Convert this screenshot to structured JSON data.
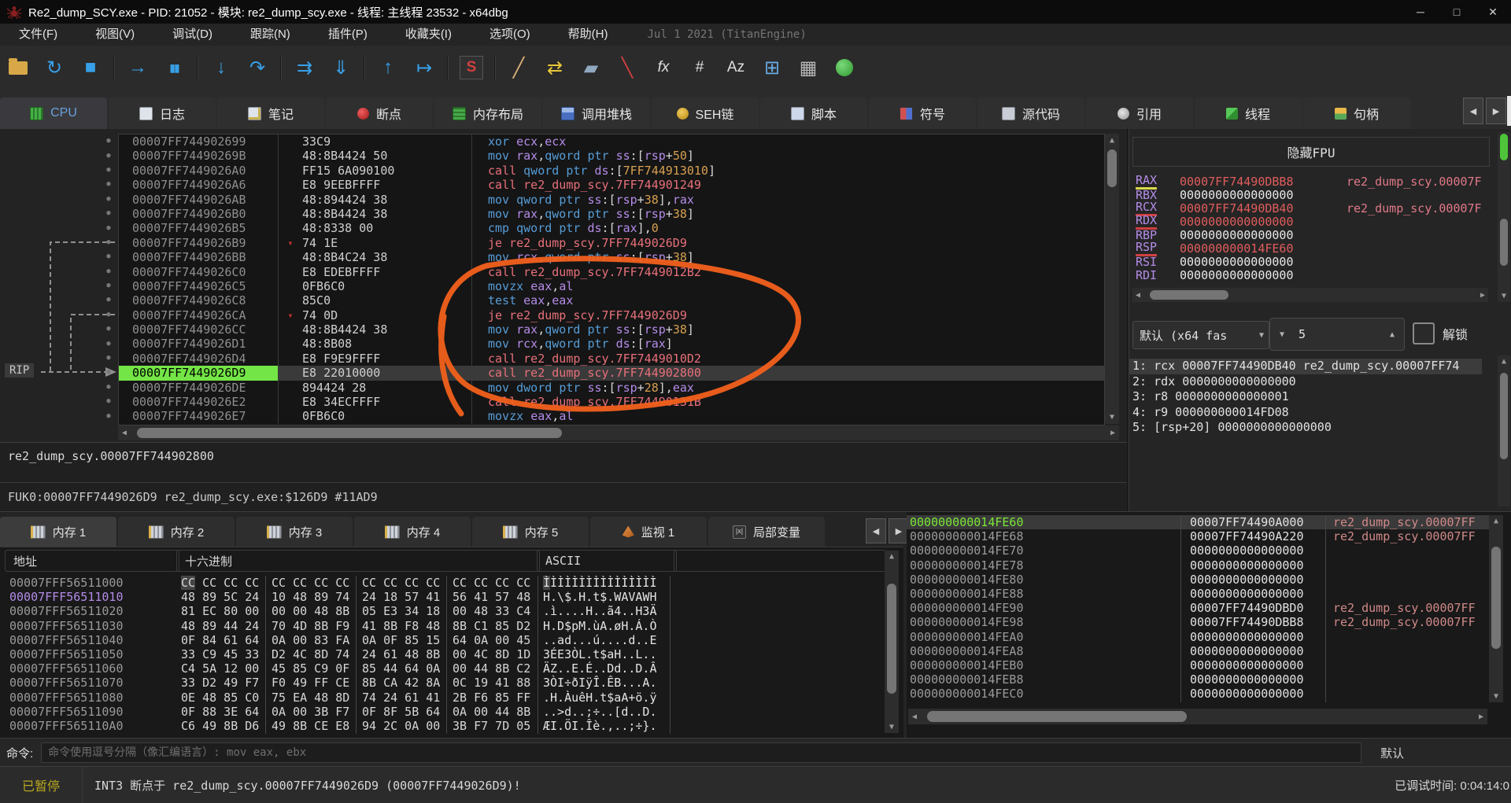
{
  "title_bar": {
    "title": "Re2_dump_SCY.exe - PID: 21052 - 模块: re2_dump_scy.exe - 线程: 主线程 23532 - x64dbg",
    "window_buttons": [
      "─",
      "□",
      "✕"
    ]
  },
  "menu_bar": {
    "items": [
      "文件(F)",
      "视图(V)",
      "调试(D)",
      "跟踪(N)",
      "插件(P)",
      "收藏夹(I)",
      "选项(O)",
      "帮助(H)"
    ],
    "build_info": "Jul 1 2021 (TitanEngine)"
  },
  "icons": {
    "up": "▲",
    "down": "▼",
    "left": "◀",
    "right": "▶",
    "jump_down": "▾",
    "dot": "●"
  },
  "toolbar": {
    "buttons": [
      {
        "name": "open-file-icon",
        "glyph": "",
        "color": "#d8a848",
        "kind": "folder"
      },
      {
        "name": "restart-icon",
        "glyph": "↻",
        "color": "#38a0e8"
      },
      {
        "name": "stop-icon",
        "glyph": "■",
        "color": "#38a0e8"
      },
      {
        "sep": true
      },
      {
        "name": "run-icon",
        "glyph": "→",
        "color": "#38a0e8"
      },
      {
        "name": "pause-icon",
        "glyph": "▮▮",
        "color": "#38a0e8",
        "small": true
      },
      {
        "sep": true
      },
      {
        "name": "step-into-icon",
        "glyph": "↓",
        "color": "#38a0e8"
      },
      {
        "name": "step-over-icon",
        "glyph": "↷",
        "color": "#38a0e8"
      },
      {
        "sep": true
      },
      {
        "name": "execute-till-return-icon",
        "glyph": "⇉",
        "color": "#38a0e8"
      },
      {
        "name": "run-to-user-code-icon",
        "glyph": "⇓",
        "color": "#38a0e8"
      },
      {
        "sep": true
      },
      {
        "name": "step-out-icon",
        "glyph": "↑",
        "color": "#38a0e8"
      },
      {
        "name": "run-until-expression-icon",
        "glyph": "↦",
        "color": "#38a0e8"
      },
      {
        "sep": true
      },
      {
        "name": "scylla-icon",
        "glyph": "S",
        "color": "#d04040",
        "kind": "scylla"
      },
      {
        "sep": true
      },
      {
        "name": "patch-icon",
        "glyph": "╱",
        "color": "#d8b078"
      },
      {
        "name": "fat-arrows-icon",
        "glyph": "⇄",
        "color": "#e8c838"
      },
      {
        "name": "eraser-icon",
        "glyph": "▰",
        "color": "#90a8c0"
      },
      {
        "name": "highlight-icon",
        "glyph": "╲",
        "color": "#d04040"
      },
      {
        "name": "function-fx-icon",
        "glyph": "fx",
        "color": "#e0e0e0",
        "text": true
      },
      {
        "name": "hash-icon",
        "glyph": "#",
        "color": "#e0e0e0",
        "text": true
      },
      {
        "name": "font-az-icon",
        "glyph": "Az",
        "color": "#e0e0e0",
        "text": true
      },
      {
        "name": "new-dump-window-icon",
        "glyph": "⊞",
        "color": "#68a8e0"
      },
      {
        "name": "calculator-icon",
        "glyph": "▦",
        "color": "#b8b8b8"
      },
      {
        "name": "internet-icon",
        "glyph": "",
        "color": "#48b848",
        "kind": "globe"
      }
    ]
  },
  "cpu_tabs": [
    {
      "label": "CPU",
      "icon": "cpu",
      "active": true
    },
    {
      "label": "日志",
      "icon": "log"
    },
    {
      "label": "笔记",
      "icon": "notes"
    },
    {
      "label": "断点",
      "icon": "breakpoint"
    },
    {
      "label": "内存布局",
      "icon": "memory-map"
    },
    {
      "label": "调用堆栈",
      "icon": "call-stack"
    },
    {
      "label": "SEH链",
      "icon": "seh"
    },
    {
      "label": "脚本",
      "icon": "script"
    },
    {
      "label": "符号",
      "icon": "symbols"
    },
    {
      "label": "源代码",
      "icon": "source"
    },
    {
      "label": "引用",
      "icon": "references"
    },
    {
      "label": "线程",
      "icon": "threads"
    },
    {
      "label": "句柄",
      "icon": "handles"
    }
  ],
  "disasm": {
    "rip_label": "RIP",
    "rows": [
      {
        "addr": "00007FF744902699",
        "bytes": "33C9",
        "instr": "xor ecx,ecx"
      },
      {
        "addr": "00007FF74490269B",
        "bytes": "48:8B4424 50",
        "instr": "mov rax,qword ptr ss:[rsp+50]"
      },
      {
        "addr": "00007FF7449026A0",
        "bytes": "FF15 6A090100",
        "instr": "call qword ptr ds:[7FF744913010]"
      },
      {
        "addr": "00007FF7449026A6",
        "bytes": "E8 9EEBFFFF",
        "instr": "call re2_dump_scy.7FF744901249"
      },
      {
        "addr": "00007FF7449026AB",
        "bytes": "48:894424 38",
        "instr": "mov qword ptr ss:[rsp+38],rax"
      },
      {
        "addr": "00007FF7449026B0",
        "bytes": "48:8B4424 38",
        "instr": "mov rax,qword ptr ss:[rsp+38]"
      },
      {
        "addr": "00007FF7449026B5",
        "bytes": "48:8338 00",
        "instr": "cmp qword ptr ds:[rax],0"
      },
      {
        "addr": "00007FF7449026B9",
        "bytes": "74 1E",
        "instr": "je re2_dump_scy.7FF7449026D9",
        "jump": true
      },
      {
        "addr": "00007FF7449026BB",
        "bytes": "48:8B4C24 38",
        "instr": "mov rcx,qword ptr ss:[rsp+38]"
      },
      {
        "addr": "00007FF7449026C0",
        "bytes": "E8 EDEBFFFF",
        "instr": "call re2_dump_scy.7FF7449012B2"
      },
      {
        "addr": "00007FF7449026C5",
        "bytes": "0FB6C0",
        "instr": "movzx eax,al"
      },
      {
        "addr": "00007FF7449026C8",
        "bytes": "85C0",
        "instr": "test eax,eax"
      },
      {
        "addr": "00007FF7449026CA",
        "bytes": "74 0D",
        "instr": "je re2_dump_scy.7FF7449026D9",
        "jump": true
      },
      {
        "addr": "00007FF7449026CC",
        "bytes": "48:8B4424 38",
        "instr": "mov rax,qword ptr ss:[rsp+38]"
      },
      {
        "addr": "00007FF7449026D1",
        "bytes": "48:8B08",
        "instr": "mov rcx,qword ptr ds:[rax]"
      },
      {
        "addr": "00007FF7449026D4",
        "bytes": "E8 F9E9FFFF",
        "instr": "call re2_dump_scy.7FF7449010D2"
      },
      {
        "addr": "00007FF7449026D9",
        "bytes": "E8 22010000",
        "instr": "call re2_dump_scy.7FF744902800",
        "rip": true
      },
      {
        "addr": "00007FF7449026DE",
        "bytes": "894424 28",
        "instr": "mov dword ptr ss:[rsp+28],eax"
      },
      {
        "addr": "00007FF7449026E2",
        "bytes": "E8 34ECFFFF",
        "instr": "call re2_dump_scy.7FF74490131B"
      },
      {
        "addr": "00007FF7449026E7",
        "bytes": "0FB6C0",
        "instr": "movzx eax,al"
      }
    ],
    "info_line": "re2_dump_scy.00007FF744902800",
    "status_line": "FUK0:00007FF7449026D9 re2_dump_scy.exe:$126D9 #11AD9"
  },
  "registers": {
    "title": "隐藏FPU",
    "rows": [
      {
        "name": "RAX",
        "value": "00007FF74490DBB8",
        "comment": "re2_dump_scy.00007F",
        "changed": true,
        "mark": "yellow"
      },
      {
        "name": "RBX",
        "value": "0000000000000000",
        "changed": false
      },
      {
        "name": "RCX",
        "value": "00007FF74490DB40",
        "comment": "re2_dump_scy.00007F",
        "changed": true,
        "mark": "red"
      },
      {
        "name": "RDX",
        "value": "0000000000000000",
        "changed": true,
        "mark": "red"
      },
      {
        "name": "RBP",
        "value": "0000000000000000",
        "changed": false
      },
      {
        "name": "RSP",
        "value": "000000000014FE60",
        "changed": true,
        "mark": "red"
      },
      {
        "name": "RSI",
        "value": "0000000000000000",
        "changed": false
      },
      {
        "name": "RDI",
        "value": "0000000000000000",
        "changed": false
      }
    ]
  },
  "args_panel": {
    "convention": "默认 (x64 fas",
    "spin_value": "5",
    "unlock": "解锁",
    "rows": [
      "1: rcx 00007FF74490DB40 re2_dump_scy.00007FF74",
      "2: rdx 0000000000000000",
      "3: r8 0000000000000001",
      "4: r9 000000000014FD08",
      "5: [rsp+20] 0000000000000000"
    ],
    "selected_index": 0
  },
  "bottom_tabs": [
    {
      "label": "内存 1",
      "icon": "memory",
      "active": true
    },
    {
      "label": "内存 2",
      "icon": "memory"
    },
    {
      "label": "内存 3",
      "icon": "memory"
    },
    {
      "label": "内存 4",
      "icon": "memory"
    },
    {
      "label": "内存 5",
      "icon": "memory"
    },
    {
      "label": "监视 1",
      "icon": "watch"
    },
    {
      "label": "局部变量",
      "icon": "locals"
    }
  ],
  "dump": {
    "headers": {
      "address": "地址",
      "hex": "十六进制",
      "ascii": "ASCII"
    },
    "rows": [
      {
        "addr": "00007FFF56511000",
        "hex": [
          "CC CC CC CC",
          "CC CC CC CC",
          "CC CC CC CC",
          "CC CC CC CC"
        ],
        "ascii": "ÌÌÌÌÌÌÌÌÌÌÌÌÌÌÌÌ",
        "cursor": true
      },
      {
        "addr": "00007FFF56511010",
        "hex": [
          "48 89 5C 24",
          "10 48 89 74",
          "24 18 57 41",
          "56 41 57 48"
        ],
        "ascii": "H.\\$.H.t$.WAVAWH",
        "sel": true
      },
      {
        "addr": "00007FFF56511020",
        "hex": [
          "81 EC 80 00",
          "00 00 48 8B",
          "05 E3 34 18",
          "00 48 33 C4"
        ],
        "ascii": ".ì....H..ã4..H3Ä"
      },
      {
        "addr": "00007FFF56511030",
        "hex": [
          "48 89 44 24",
          "70 4D 8B F9",
          "41 8B F8 48",
          "8B C1 85 D2"
        ],
        "ascii": "H.D$pM.ùA.øH.Á.Ò"
      },
      {
        "addr": "00007FFF56511040",
        "hex": [
          "0F 84 61 64",
          "0A 00 83 FA",
          "0A 0F 85 15",
          "64 0A 00 45"
        ],
        "ascii": "..ad...ú....d..E"
      },
      {
        "addr": "00007FFF56511050",
        "hex": [
          "33 C9 45 33",
          "D2 4C 8D 74",
          "24 61 48 8B",
          "00 4C 8D 1D"
        ],
        "ascii": "3ÉE3ÒL.t$aH..L.."
      },
      {
        "addr": "00007FFF56511060",
        "hex": [
          "C4 5A 12 00",
          "45 85 C9 0F",
          "85 44 64 0A",
          "00 44 8B C2"
        ],
        "ascii": "ÄZ..E.É..Dd..D.Â"
      },
      {
        "addr": "00007FFF56511070",
        "hex": [
          "33 D2 49 F7",
          "F0 49 FF CE",
          "8B CA 42 8A",
          "0C 19 41 88"
        ],
        "ascii": "3ÒI÷ðIÿÎ.ÊB...A."
      },
      {
        "addr": "00007FFF56511080",
        "hex": [
          "0E 48 85 C0",
          "75 EA 48 8D",
          "74 24 61 41",
          "2B F6 85 FF"
        ],
        "ascii": ".H.ÀuêH.t$aA+ö.ÿ"
      },
      {
        "addr": "00007FFF56511090",
        "hex": [
          "0F 88 3E 64",
          "0A 00 3B F7",
          "0F 8F 5B 64",
          "0A 00 44 8B"
        ],
        "ascii": "..>d..;÷..[d..D."
      },
      {
        "addr": "00007FFF565110A0",
        "hex": [
          "C6 49 8B D6",
          "49 8B CE E8",
          "94 2C 0A 00",
          "3B F7 7D 05"
        ],
        "ascii": "ÆI.ÖI.Îè.,..;÷}."
      }
    ]
  },
  "stack": {
    "rows": [
      {
        "addr": "000000000014FE60",
        "value": "00007FF74490A000",
        "comment": "re2_dump_scy.00007FF",
        "selected": true
      },
      {
        "addr": "000000000014FE68",
        "value": "00007FF74490A220",
        "comment": "re2_dump_scy.00007FF"
      },
      {
        "addr": "000000000014FE70",
        "value": "0000000000000000"
      },
      {
        "addr": "000000000014FE78",
        "value": "0000000000000000"
      },
      {
        "addr": "000000000014FE80",
        "value": "0000000000000000"
      },
      {
        "addr": "000000000014FE88",
        "value": "0000000000000000"
      },
      {
        "addr": "000000000014FE90",
        "value": "00007FF74490DBD0",
        "comment": "re2_dump_scy.00007FF"
      },
      {
        "addr": "000000000014FE98",
        "value": "00007FF74490DBB8",
        "comment": "re2_dump_scy.00007FF"
      },
      {
        "addr": "000000000014FEA0",
        "value": "0000000000000000"
      },
      {
        "addr": "000000000014FEA8",
        "value": "0000000000000000"
      },
      {
        "addr": "000000000014FEB0",
        "value": "0000000000000000"
      },
      {
        "addr": "000000000014FEB8",
        "value": "0000000000000000"
      },
      {
        "addr": "000000000014FEC0",
        "value": "0000000000000000"
      }
    ]
  },
  "command_bar": {
    "label": "命令:",
    "placeholder": "命令使用逗号分隔（像汇编语言）: mov eax, ebx",
    "profile": "默认"
  },
  "status_bar": {
    "state": "已暂停",
    "message": "INT3 断点于 re2_dump_scy.00007FF7449026D9 (00007FF7449026D9)!",
    "debug_time": "已调试时间: 0:04:14:0"
  },
  "annotation_color": "#f2601c"
}
